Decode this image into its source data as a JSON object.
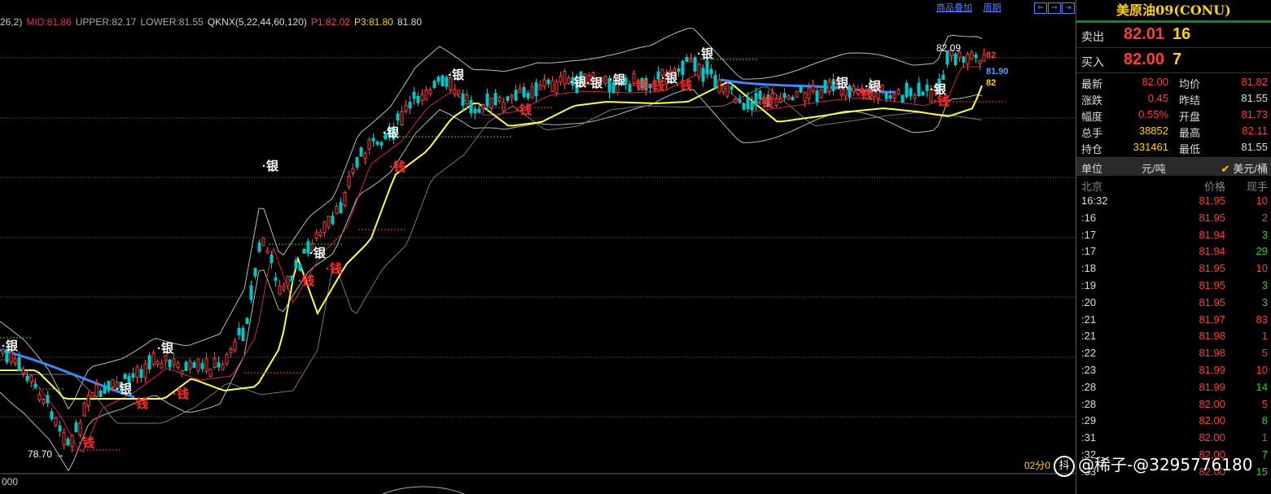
{
  "top_menu": {
    "overlay": "商品叠加",
    "period": "周期"
  },
  "indicators": [
    {
      "text": "26,2)",
      "color": "#cccccc"
    },
    {
      "text": "MID:81.86",
      "color": "#e0306a"
    },
    {
      "text": "UPPER:82.17",
      "color": "#aaaaaa"
    },
    {
      "text": "LOWER:81.55",
      "color": "#aaaaaa"
    },
    {
      "text": "QKNX(5,22,44,60,120)",
      "color": "#dddddd"
    },
    {
      "text": "P1:82.02",
      "color": "#ff4040"
    },
    {
      "text": "P3:81.80",
      "color": "#ffd200"
    },
    {
      "text": "81.80",
      "color": "#dddddd"
    }
  ],
  "chart": {
    "high_label": "82.09",
    "low_label": "78.70",
    "right_label_1": "82",
    "right_label_2": "81.90",
    "right_label_3": "82",
    "period_label": "02分0",
    "volume_axis_label": "000",
    "signals": {
      "buy": "银",
      "sell": "钱"
    }
  },
  "colors": {
    "up": "#ff3b3b",
    "down": "#00c8c8",
    "ma_yellow": "#ffff40",
    "ma_blue": "#3a8aff",
    "grid": "#666666"
  },
  "panel": {
    "title": "美原油09(CONU)",
    "ask": {
      "label": "卖出",
      "price": "82.01",
      "volume": "16"
    },
    "bid": {
      "label": "买入",
      "price": "82.00",
      "volume": "7"
    },
    "stats": [
      {
        "l1": "最新",
        "v1": "82.00",
        "c1": "#ff3b3b",
        "l2": "均价",
        "v2": "81.82",
        "c2": "#ff3b3b"
      },
      {
        "l1": "涨跌",
        "v1": "0.45",
        "c1": "#ff3b3b",
        "l2": "昨结",
        "v2": "81.55",
        "c2": "#dddddd"
      },
      {
        "l1": "幅度",
        "v1": "0.55%",
        "c1": "#ff3b3b",
        "l2": "开盘",
        "v2": "81.73",
        "c2": "#ff3b3b"
      },
      {
        "l1": "总手",
        "v1": "38852",
        "c1": "#ffd200",
        "l2": "最高",
        "v2": "82.11",
        "c2": "#ff3b3b"
      },
      {
        "l1": "持仓",
        "v1": "331461",
        "c1": "#ffd200",
        "l2": "最低",
        "v2": "81.55",
        "c2": "#dddddd"
      }
    ],
    "unit": {
      "label": "单位",
      "option1": "元/吨",
      "option2": "美元/桶"
    },
    "tick_headers": {
      "city": "北京",
      "price": "价格",
      "volume": "现手"
    },
    "ticks": [
      {
        "time": "16:32",
        "price": "81.95",
        "vol": "10",
        "vc": "#ff3b3b"
      },
      {
        "time": ":16",
        "price": "81.95",
        "vol": "2",
        "vc": "#ff3b3b"
      },
      {
        "time": ":17",
        "price": "81.94",
        "vol": "3",
        "vc": "#2ad42a"
      },
      {
        "time": ":17",
        "price": "81.94",
        "vol": "29",
        "vc": "#2ad42a"
      },
      {
        "time": ":18",
        "price": "81.95",
        "vol": "10",
        "vc": "#ff3b3b"
      },
      {
        "time": ":19",
        "price": "81.95",
        "vol": "3",
        "vc": "#2ad42a"
      },
      {
        "time": ":20",
        "price": "81.95",
        "vol": "3",
        "vc": "#2ad42a"
      },
      {
        "time": ":21",
        "price": "81.97",
        "vol": "83",
        "vc": "#ff3b3b"
      },
      {
        "time": ":21",
        "price": "81.98",
        "vol": "1",
        "vc": "#ff3b3b"
      },
      {
        "time": ":22",
        "price": "81.98",
        "vol": "5",
        "vc": "#ff3b3b"
      },
      {
        "time": ":23",
        "price": "81.99",
        "vol": "10",
        "vc": "#ff3b3b"
      },
      {
        "time": ":28",
        "price": "81.99",
        "vol": "14",
        "vc": "#2ad42a"
      },
      {
        "time": ":28",
        "price": "82.00",
        "vol": "5",
        "vc": "#ff3b3b"
      },
      {
        "time": ":29",
        "price": "82.00",
        "vol": "8",
        "vc": "#2ad42a"
      },
      {
        "time": ":31",
        "price": "82.00",
        "vol": "1",
        "vc": "#ff3b3b"
      },
      {
        "time": ":32",
        "price": "82.00",
        "vol": "7",
        "vc": "#2ad42a"
      },
      {
        "time": ":33",
        "price": "82.00",
        "vol": "15",
        "vc": "#2ad42a"
      }
    ]
  },
  "watermark": {
    "icon": "抖",
    "text": "@稀子-@3295776180"
  }
}
